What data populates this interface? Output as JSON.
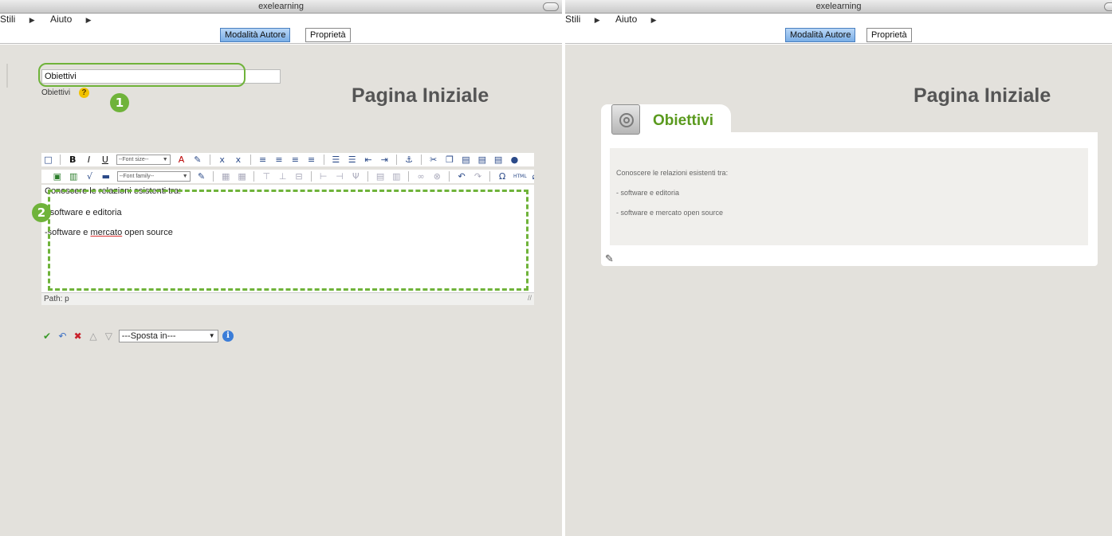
{
  "left": {
    "window_title": "exelearning",
    "menu": [
      {
        "label": "Stili"
      },
      {
        "label": "Aiuto"
      }
    ],
    "tabs": {
      "authoring": "Modalità Autore",
      "properties": "Proprietà"
    },
    "page_title": "Pagina Iniziale",
    "title_input_value": "Obiettivi",
    "field_label": "Obiettivi",
    "toolbar_selects": {
      "font_size": "--Font size--",
      "font_family": "--Font family--"
    },
    "editor_lines": [
      "Conoscere le relazioni esistenti tra:",
      "- software e editoria"
    ],
    "editor_line3_pre": "-software e ",
    "editor_line3_misspelled": "mercato",
    "editor_line3_post": " open source",
    "path_text": "Path: p",
    "move_select": "---Sposta in---",
    "callouts": {
      "one": "1",
      "two": "2"
    }
  },
  "right": {
    "window_title": "exelearning",
    "menu": [
      {
        "label": "Stili"
      },
      {
        "label": "Aiuto"
      }
    ],
    "tabs": {
      "authoring": "Modalità Autore",
      "properties": "Proprietà"
    },
    "page_title": "Pagina Iniziale",
    "idevice_title": "Obiettivi",
    "lines": [
      "Conoscere le relazioni esistenti tra:",
      "- software e editoria",
      "- software e mercato open source"
    ]
  },
  "colors": {
    "callout_green": "#6fb33a",
    "idevice_title": "#5a9a1e",
    "canvas": "#e3e1dc",
    "active_tab": "#7aaee6"
  },
  "icons": {
    "menu_arrow": "triangle-right-icon",
    "help": "help-icon",
    "confirm": "checkmark-icon",
    "undo": "undo-icon",
    "delete": "delete-icon",
    "move_up": "arrow-up-icon",
    "move_down": "arrow-down-icon",
    "info": "info-icon",
    "idevice": "target-icon",
    "edit": "edit-icon"
  }
}
